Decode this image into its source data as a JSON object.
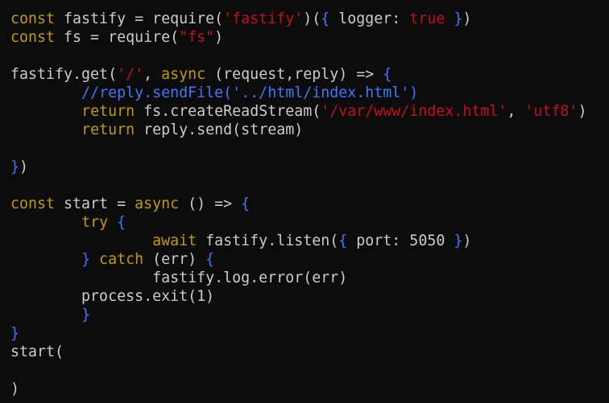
{
  "editor": {
    "colors": {
      "background": "#0c0c0c",
      "plain": "#cccccc",
      "keyword": "#c19c00",
      "string": "#c50f1f",
      "brace": "#3b78ff",
      "comment": "#3b78ff"
    },
    "lines": [
      [
        [
          "kw",
          "const"
        ],
        [
          "plain",
          " fastify = require("
        ],
        [
          "red",
          "'fastify'"
        ],
        [
          "plain",
          ")("
        ],
        [
          "brace",
          "{"
        ],
        [
          "plain",
          " logger: "
        ],
        [
          "red",
          "true"
        ],
        [
          "plain",
          " "
        ],
        [
          "brace",
          "}"
        ],
        [
          "plain",
          ")"
        ]
      ],
      [
        [
          "kw",
          "const"
        ],
        [
          "plain",
          " fs = require("
        ],
        [
          "red",
          "\"fs\""
        ],
        [
          "plain",
          ")"
        ]
      ],
      [],
      [
        [
          "plain",
          "fastify.get("
        ],
        [
          "red",
          "'/'"
        ],
        [
          "plain",
          ", "
        ],
        [
          "kw",
          "async"
        ],
        [
          "plain",
          " (request,reply) => "
        ],
        [
          "brace",
          "{"
        ]
      ],
      [
        [
          "plain",
          "        "
        ],
        [
          "cmt",
          "//reply.sendFile('../html/index.html')"
        ]
      ],
      [
        [
          "plain",
          "        "
        ],
        [
          "kw",
          "return"
        ],
        [
          "plain",
          " fs.createReadStream("
        ],
        [
          "red",
          "'/var/www/index.html'"
        ],
        [
          "plain",
          ", "
        ],
        [
          "red",
          "'utf8'"
        ],
        [
          "plain",
          ")"
        ]
      ],
      [
        [
          "plain",
          "        "
        ],
        [
          "kw",
          "return"
        ],
        [
          "plain",
          " reply.send(stream)"
        ]
      ],
      [],
      [
        [
          "brace",
          "}"
        ],
        [
          "plain",
          ")"
        ]
      ],
      [],
      [
        [
          "kw",
          "const"
        ],
        [
          "plain",
          " start = "
        ],
        [
          "kw",
          "async"
        ],
        [
          "plain",
          " () => "
        ],
        [
          "brace",
          "{"
        ]
      ],
      [
        [
          "plain",
          "        "
        ],
        [
          "kw",
          "try"
        ],
        [
          "plain",
          " "
        ],
        [
          "brace",
          "{"
        ]
      ],
      [
        [
          "plain",
          "                "
        ],
        [
          "kw",
          "await"
        ],
        [
          "plain",
          " fastify.listen("
        ],
        [
          "brace",
          "{"
        ],
        [
          "plain",
          " port: 5050 "
        ],
        [
          "brace",
          "}"
        ],
        [
          "plain",
          ")"
        ]
      ],
      [
        [
          "plain",
          "        "
        ],
        [
          "brace",
          "}"
        ],
        [
          "plain",
          " "
        ],
        [
          "kw",
          "catch"
        ],
        [
          "plain",
          " (err) "
        ],
        [
          "brace",
          "{"
        ]
      ],
      [
        [
          "plain",
          "                fastify.log.error(err)"
        ]
      ],
      [
        [
          "plain",
          "        process.exit(1)"
        ]
      ],
      [
        [
          "plain",
          "        "
        ],
        [
          "brace",
          "}"
        ]
      ],
      [
        [
          "brace",
          "}"
        ]
      ],
      [
        [
          "plain",
          "start("
        ]
      ],
      [],
      [
        [
          "plain",
          ")"
        ]
      ]
    ]
  }
}
